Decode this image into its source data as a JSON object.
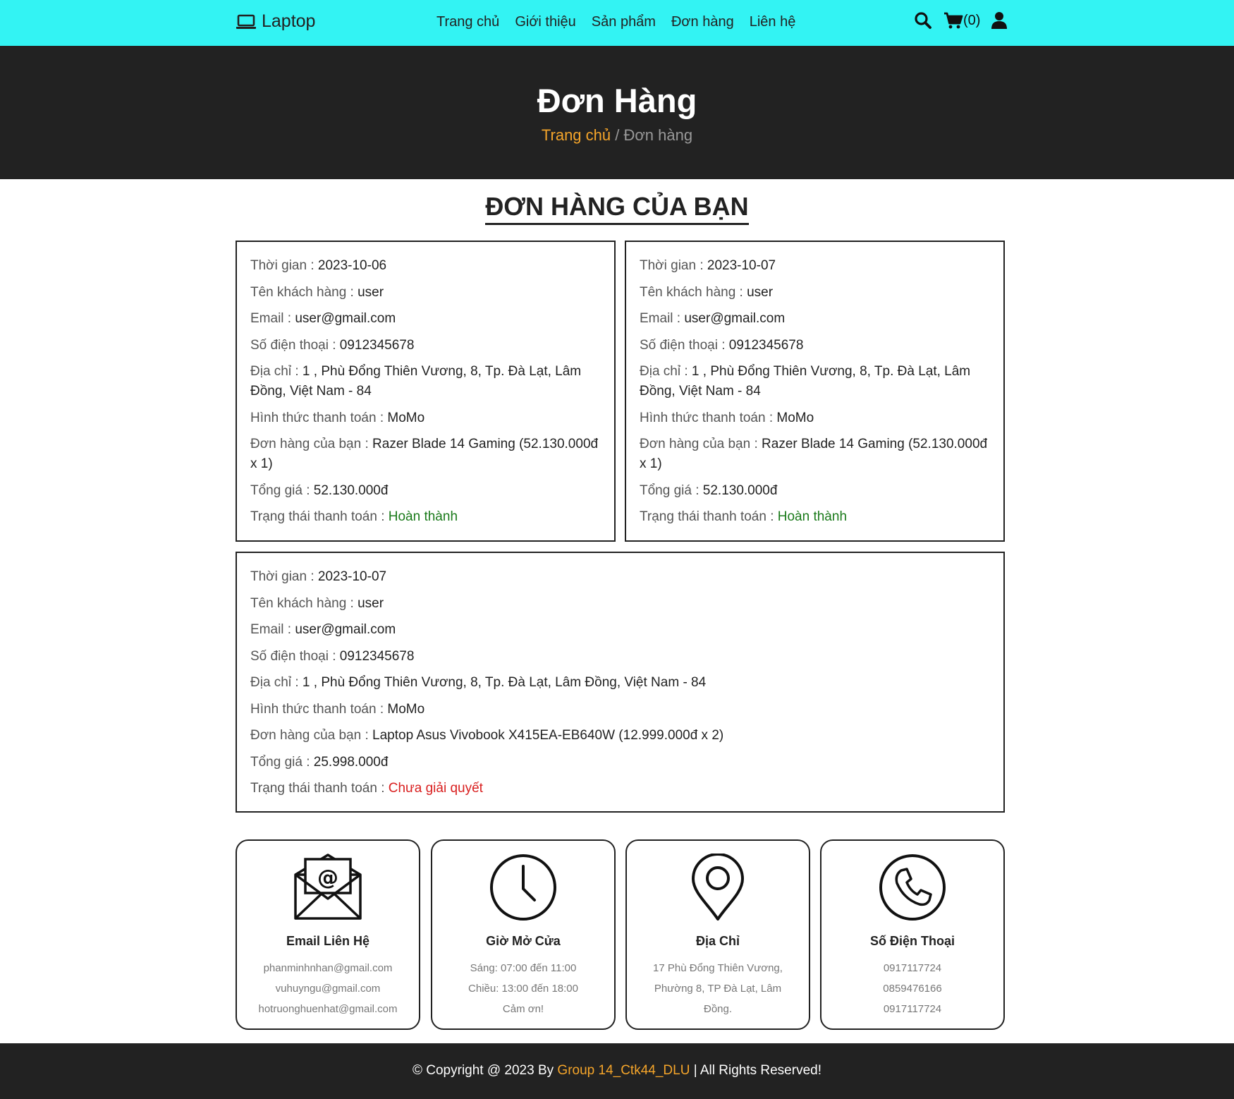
{
  "header": {
    "brand": "Laptop",
    "nav": [
      "Trang chủ",
      "Giới thiệu",
      "Sản phẩm",
      "Đơn hàng",
      "Liên hệ"
    ],
    "cart_count": "(0)",
    "icons": [
      "laptop-icon",
      "search-icon",
      "cart-icon",
      "user-icon"
    ]
  },
  "banner": {
    "title": "Đơn Hàng",
    "breadcrumb_home": "Trang chủ",
    "breadcrumb_sep": " / ",
    "breadcrumb_current": "Đơn hàng"
  },
  "section_title": "ĐƠN HÀNG CỦA BẠN",
  "labels": {
    "time": "Thời gian : ",
    "customer": "Tên khách hàng : ",
    "email": "Email : ",
    "phone": "Số điện thoại : ",
    "address": "Địa chỉ : ",
    "payment": "Hình thức thanh toán : ",
    "items": "Đơn hàng của bạn : ",
    "total": "Tổng giá : ",
    "status": "Trạng thái thanh toán : "
  },
  "orders": [
    {
      "time": "2023-10-06",
      "customer": "user",
      "email": "user@gmail.com",
      "phone": "0912345678",
      "address": "1 , Phù Đổng Thiên Vương, 8, Tp. Đà Lạt, Lâm Đồng, Việt Nam - 84",
      "payment": "MoMo",
      "items": "Razer Blade 14 Gaming (52.130.000đ x 1)",
      "total": "52.130.000đ",
      "status": "Hoàn thành"
    },
    {
      "time": "2023-10-07",
      "customer": "user",
      "email": "user@gmail.com",
      "phone": "0912345678",
      "address": "1 , Phù Đổng Thiên Vương, 8, Tp. Đà Lạt, Lâm Đồng, Việt Nam - 84",
      "payment": "MoMo",
      "items": "Razer Blade 14 Gaming (52.130.000đ x 1)",
      "total": "52.130.000đ",
      "status": "Hoàn thành"
    },
    {
      "time": "2023-10-07",
      "customer": "user",
      "email": "user@gmail.com",
      "phone": "0912345678",
      "address": "1 , Phù Đổng Thiên Vương, 8, Tp. Đà Lạt, Lâm Đồng, Việt Nam - 84",
      "payment": "MoMo",
      "items": "Laptop Asus Vivobook X415EA-EB640W (12.999.000đ x 2)",
      "total": "25.998.000đ",
      "status": "Chưa giải quyết"
    }
  ],
  "contact": [
    {
      "icon": "envelope-icon",
      "title": "Email Liên Hệ",
      "lines": [
        "phanminhnhan@gmail.com",
        "vuhuyngu@gmail.com",
        "hotruonghuenhat@gmail.com"
      ]
    },
    {
      "icon": "clock-icon",
      "title": "Giờ Mở Cửa",
      "lines": [
        "Sáng: 07:00 đến 11:00",
        "Chiều: 13:00 đến 18:00",
        "Cảm ơn!"
      ]
    },
    {
      "icon": "map-pin-icon",
      "title": "Địa Chỉ",
      "lines": [
        "17 Phù Đổng Thiên Vương,",
        "Phường 8, TP Đà Lạt, Lâm",
        "Đồng."
      ]
    },
    {
      "icon": "phone-icon",
      "title": "Số Điện Thoại",
      "lines": [
        "0917117724",
        "0859476166",
        "0917117724"
      ]
    }
  ],
  "footer": {
    "prefix": "© Copyright @ 2023 By ",
    "group": "Group 14_Ctk44_DLU",
    "suffix": " | All Rights Reserved!"
  },
  "colors": {
    "topbar": "#33f3f3",
    "banner": "#222222",
    "accent": "#f5a52a",
    "status_done": "#1a7a1a",
    "status_pending": "#d92020"
  }
}
